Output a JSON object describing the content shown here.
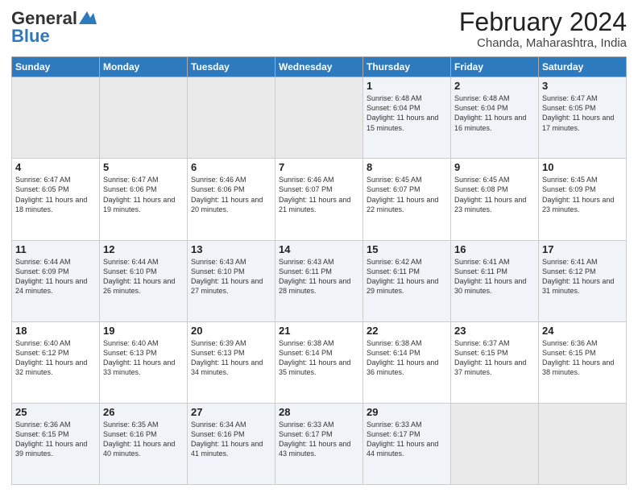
{
  "logo": {
    "line1": "General",
    "line2": "Blue"
  },
  "title": "February 2024",
  "subtitle": "Chanda, Maharashtra, India",
  "weekdays": [
    "Sunday",
    "Monday",
    "Tuesday",
    "Wednesday",
    "Thursday",
    "Friday",
    "Saturday"
  ],
  "weeks": [
    [
      {
        "day": "",
        "sunrise": "",
        "sunset": "",
        "daylight": "",
        "empty": true
      },
      {
        "day": "",
        "sunrise": "",
        "sunset": "",
        "daylight": "",
        "empty": true
      },
      {
        "day": "",
        "sunrise": "",
        "sunset": "",
        "daylight": "",
        "empty": true
      },
      {
        "day": "",
        "sunrise": "",
        "sunset": "",
        "daylight": "",
        "empty": true
      },
      {
        "day": "1",
        "sunrise": "Sunrise: 6:48 AM",
        "sunset": "Sunset: 6:04 PM",
        "daylight": "Daylight: 11 hours and 15 minutes."
      },
      {
        "day": "2",
        "sunrise": "Sunrise: 6:48 AM",
        "sunset": "Sunset: 6:04 PM",
        "daylight": "Daylight: 11 hours and 16 minutes."
      },
      {
        "day": "3",
        "sunrise": "Sunrise: 6:47 AM",
        "sunset": "Sunset: 6:05 PM",
        "daylight": "Daylight: 11 hours and 17 minutes."
      }
    ],
    [
      {
        "day": "4",
        "sunrise": "Sunrise: 6:47 AM",
        "sunset": "Sunset: 6:05 PM",
        "daylight": "Daylight: 11 hours and 18 minutes."
      },
      {
        "day": "5",
        "sunrise": "Sunrise: 6:47 AM",
        "sunset": "Sunset: 6:06 PM",
        "daylight": "Daylight: 11 hours and 19 minutes."
      },
      {
        "day": "6",
        "sunrise": "Sunrise: 6:46 AM",
        "sunset": "Sunset: 6:06 PM",
        "daylight": "Daylight: 11 hours and 20 minutes."
      },
      {
        "day": "7",
        "sunrise": "Sunrise: 6:46 AM",
        "sunset": "Sunset: 6:07 PM",
        "daylight": "Daylight: 11 hours and 21 minutes."
      },
      {
        "day": "8",
        "sunrise": "Sunrise: 6:45 AM",
        "sunset": "Sunset: 6:07 PM",
        "daylight": "Daylight: 11 hours and 22 minutes."
      },
      {
        "day": "9",
        "sunrise": "Sunrise: 6:45 AM",
        "sunset": "Sunset: 6:08 PM",
        "daylight": "Daylight: 11 hours and 23 minutes."
      },
      {
        "day": "10",
        "sunrise": "Sunrise: 6:45 AM",
        "sunset": "Sunset: 6:09 PM",
        "daylight": "Daylight: 11 hours and 23 minutes."
      }
    ],
    [
      {
        "day": "11",
        "sunrise": "Sunrise: 6:44 AM",
        "sunset": "Sunset: 6:09 PM",
        "daylight": "Daylight: 11 hours and 24 minutes."
      },
      {
        "day": "12",
        "sunrise": "Sunrise: 6:44 AM",
        "sunset": "Sunset: 6:10 PM",
        "daylight": "Daylight: 11 hours and 26 minutes."
      },
      {
        "day": "13",
        "sunrise": "Sunrise: 6:43 AM",
        "sunset": "Sunset: 6:10 PM",
        "daylight": "Daylight: 11 hours and 27 minutes."
      },
      {
        "day": "14",
        "sunrise": "Sunrise: 6:43 AM",
        "sunset": "Sunset: 6:11 PM",
        "daylight": "Daylight: 11 hours and 28 minutes."
      },
      {
        "day": "15",
        "sunrise": "Sunrise: 6:42 AM",
        "sunset": "Sunset: 6:11 PM",
        "daylight": "Daylight: 11 hours and 29 minutes."
      },
      {
        "day": "16",
        "sunrise": "Sunrise: 6:41 AM",
        "sunset": "Sunset: 6:11 PM",
        "daylight": "Daylight: 11 hours and 30 minutes."
      },
      {
        "day": "17",
        "sunrise": "Sunrise: 6:41 AM",
        "sunset": "Sunset: 6:12 PM",
        "daylight": "Daylight: 11 hours and 31 minutes."
      }
    ],
    [
      {
        "day": "18",
        "sunrise": "Sunrise: 6:40 AM",
        "sunset": "Sunset: 6:12 PM",
        "daylight": "Daylight: 11 hours and 32 minutes."
      },
      {
        "day": "19",
        "sunrise": "Sunrise: 6:40 AM",
        "sunset": "Sunset: 6:13 PM",
        "daylight": "Daylight: 11 hours and 33 minutes."
      },
      {
        "day": "20",
        "sunrise": "Sunrise: 6:39 AM",
        "sunset": "Sunset: 6:13 PM",
        "daylight": "Daylight: 11 hours and 34 minutes."
      },
      {
        "day": "21",
        "sunrise": "Sunrise: 6:38 AM",
        "sunset": "Sunset: 6:14 PM",
        "daylight": "Daylight: 11 hours and 35 minutes."
      },
      {
        "day": "22",
        "sunrise": "Sunrise: 6:38 AM",
        "sunset": "Sunset: 6:14 PM",
        "daylight": "Daylight: 11 hours and 36 minutes."
      },
      {
        "day": "23",
        "sunrise": "Sunrise: 6:37 AM",
        "sunset": "Sunset: 6:15 PM",
        "daylight": "Daylight: 11 hours and 37 minutes."
      },
      {
        "day": "24",
        "sunrise": "Sunrise: 6:36 AM",
        "sunset": "Sunset: 6:15 PM",
        "daylight": "Daylight: 11 hours and 38 minutes."
      }
    ],
    [
      {
        "day": "25",
        "sunrise": "Sunrise: 6:36 AM",
        "sunset": "Sunset: 6:15 PM",
        "daylight": "Daylight: 11 hours and 39 minutes."
      },
      {
        "day": "26",
        "sunrise": "Sunrise: 6:35 AM",
        "sunset": "Sunset: 6:16 PM",
        "daylight": "Daylight: 11 hours and 40 minutes."
      },
      {
        "day": "27",
        "sunrise": "Sunrise: 6:34 AM",
        "sunset": "Sunset: 6:16 PM",
        "daylight": "Daylight: 11 hours and 41 minutes."
      },
      {
        "day": "28",
        "sunrise": "Sunrise: 6:33 AM",
        "sunset": "Sunset: 6:17 PM",
        "daylight": "Daylight: 11 hours and 43 minutes."
      },
      {
        "day": "29",
        "sunrise": "Sunrise: 6:33 AM",
        "sunset": "Sunset: 6:17 PM",
        "daylight": "Daylight: 11 hours and 44 minutes."
      },
      {
        "day": "",
        "sunrise": "",
        "sunset": "",
        "daylight": "",
        "empty": true
      },
      {
        "day": "",
        "sunrise": "",
        "sunset": "",
        "daylight": "",
        "empty": true
      }
    ]
  ]
}
